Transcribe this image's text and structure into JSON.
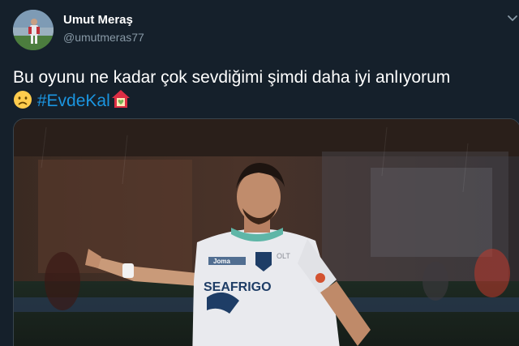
{
  "author": {
    "display_name": "Umut Meraş",
    "handle": "@umutmeras77"
  },
  "tweet": {
    "text": "Bu oyunu ne kadar çok sevdiğimi şimdi daha iyi anlıyorum",
    "hashtag": "#EvdeKal"
  },
  "media": {
    "jersey_text": "SEAFRIGO",
    "jersey_brand": "Joma",
    "jersey_sponsor": "OLT"
  },
  "icons": {
    "sad_face": "sad-face-emoji",
    "house_heart": "house-with-heart-emoji",
    "caret": "chevron-down-icon"
  },
  "colors": {
    "background": "#15202b",
    "text": "#ffffff",
    "secondary_text": "#8899a6",
    "link": "#1b95e0",
    "border": "#38444d"
  }
}
